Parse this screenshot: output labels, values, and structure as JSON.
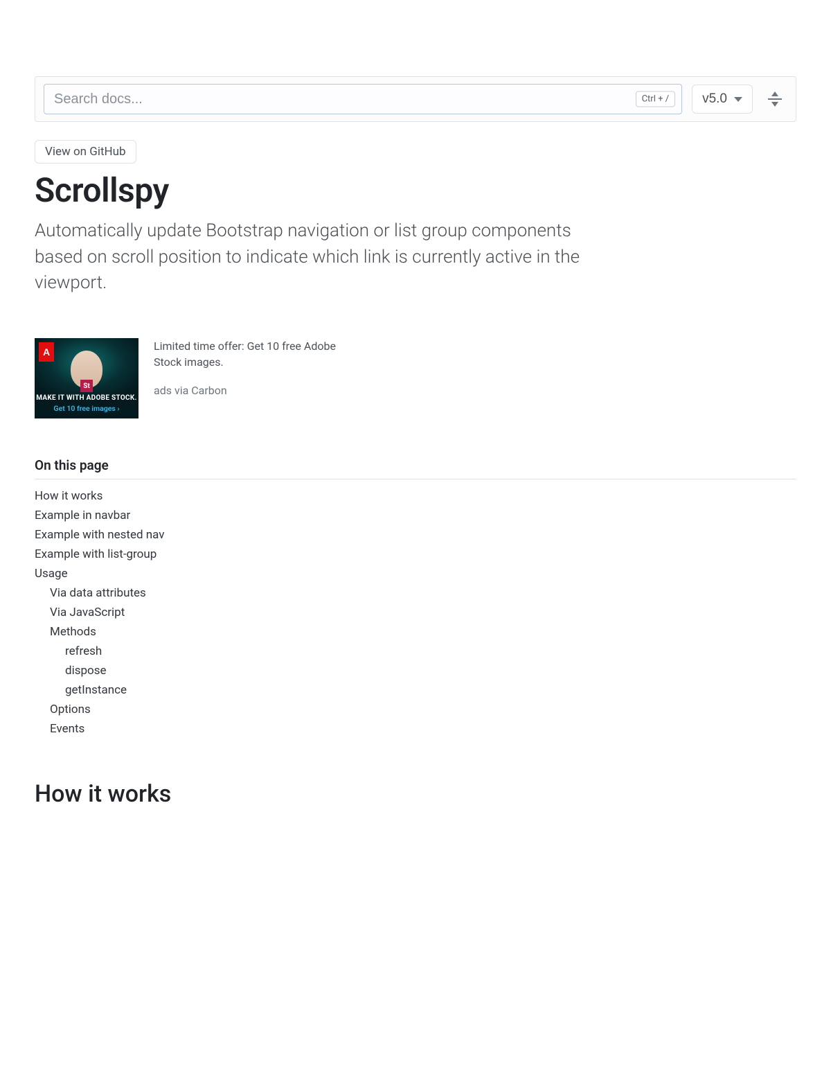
{
  "toolbar": {
    "search_placeholder": "Search docs...",
    "kbd_hint": "Ctrl + /",
    "version_label": "v5.0"
  },
  "header": {
    "github_label": "View on GitHub",
    "title": "Scrollspy",
    "lead": "Automatically update Bootstrap navigation or list group components based on scroll position to indicate which link is currently active in the viewport."
  },
  "ad": {
    "headline": "Limited time offer: Get 10 free Adobe Stock images.",
    "via": "ads via Carbon",
    "image_line1": "MAKE IT WITH ADOBE STOCK.",
    "image_line2": "Get 10 free images ›",
    "st_label": "St"
  },
  "on_this_page": {
    "heading": "On this page",
    "items": [
      {
        "label": "How it works",
        "level": 1
      },
      {
        "label": "Example in navbar",
        "level": 1
      },
      {
        "label": "Example with nested nav",
        "level": 1
      },
      {
        "label": "Example with list-group",
        "level": 1
      },
      {
        "label": "Usage",
        "level": 1
      },
      {
        "label": "Via data attributes",
        "level": 2
      },
      {
        "label": "Via JavaScript",
        "level": 2
      },
      {
        "label": "Methods",
        "level": 2
      },
      {
        "label": "refresh",
        "level": 3
      },
      {
        "label": "dispose",
        "level": 3
      },
      {
        "label": "getInstance",
        "level": 3
      },
      {
        "label": "Options",
        "level": 2
      },
      {
        "label": "Events",
        "level": 2
      }
    ]
  },
  "sections": {
    "how_it_works_heading": "How it works"
  }
}
